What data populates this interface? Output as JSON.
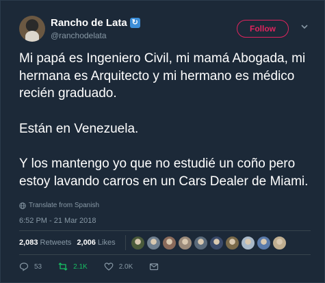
{
  "author": {
    "display_name": "Rancho de Lata",
    "handle": "@ranchodelata"
  },
  "follow_label": "Follow",
  "tweet": {
    "paragraphs": [
      "Mi papá es Ingeniero Civil, mi mamá Abogada, mi hermana es Arquitecto y mi hermano es médico recién graduado.",
      "Están en Venezuela.",
      "Y los mantengo yo que no estudié un coño pero estoy lavando carros en un Cars Dealer de Miami."
    ],
    "translate_label": "Translate from Spanish",
    "timestamp": "6:52 PM - 21 Mar 2018"
  },
  "stats": {
    "retweets_count": "2,083",
    "retweets_label": "Retweets",
    "likes_count": "2,006",
    "likes_label": "Likes"
  },
  "actions": {
    "replies": "53",
    "retweets": "2.1K",
    "likes": "2.0K"
  },
  "colors": {
    "background": "#1c2938",
    "accent_follow": "#e0245e",
    "retweet_green": "#17bf63",
    "muted": "#8899a6"
  },
  "icons": [
    "verified-icon",
    "chevron-down-icon",
    "globe-icon",
    "reply-icon",
    "retweet-icon",
    "like-icon",
    "message-icon"
  ],
  "liker_avatar_colors": [
    "#4a5a3a",
    "#6f7f8f",
    "#8a6a5a",
    "#9a8a7a",
    "#5a6a7a",
    "#3a4a6a",
    "#7a6a4a",
    "#a9b9c9",
    "#5a7aaa",
    "#bfae90"
  ]
}
